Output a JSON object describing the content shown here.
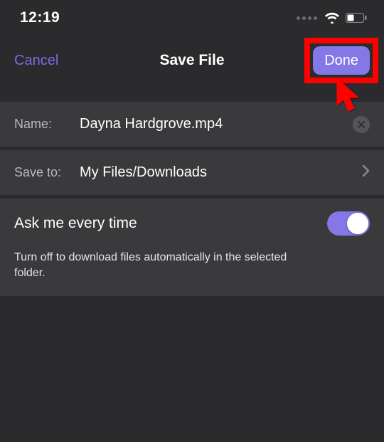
{
  "status": {
    "time": "12:19"
  },
  "header": {
    "cancel_label": "Cancel",
    "title": "Save File",
    "done_label": "Done"
  },
  "name_row": {
    "label": "Name:",
    "value": "Dayna Hardgrove.mp4"
  },
  "saveto_row": {
    "label": "Save to:",
    "value": "My Files/Downloads"
  },
  "ask_row": {
    "label": "Ask me every time",
    "on": true,
    "help": "Turn off to download files automatically in the selected folder."
  },
  "colors": {
    "accent": "#8477e6",
    "highlight": "#ff0000"
  }
}
